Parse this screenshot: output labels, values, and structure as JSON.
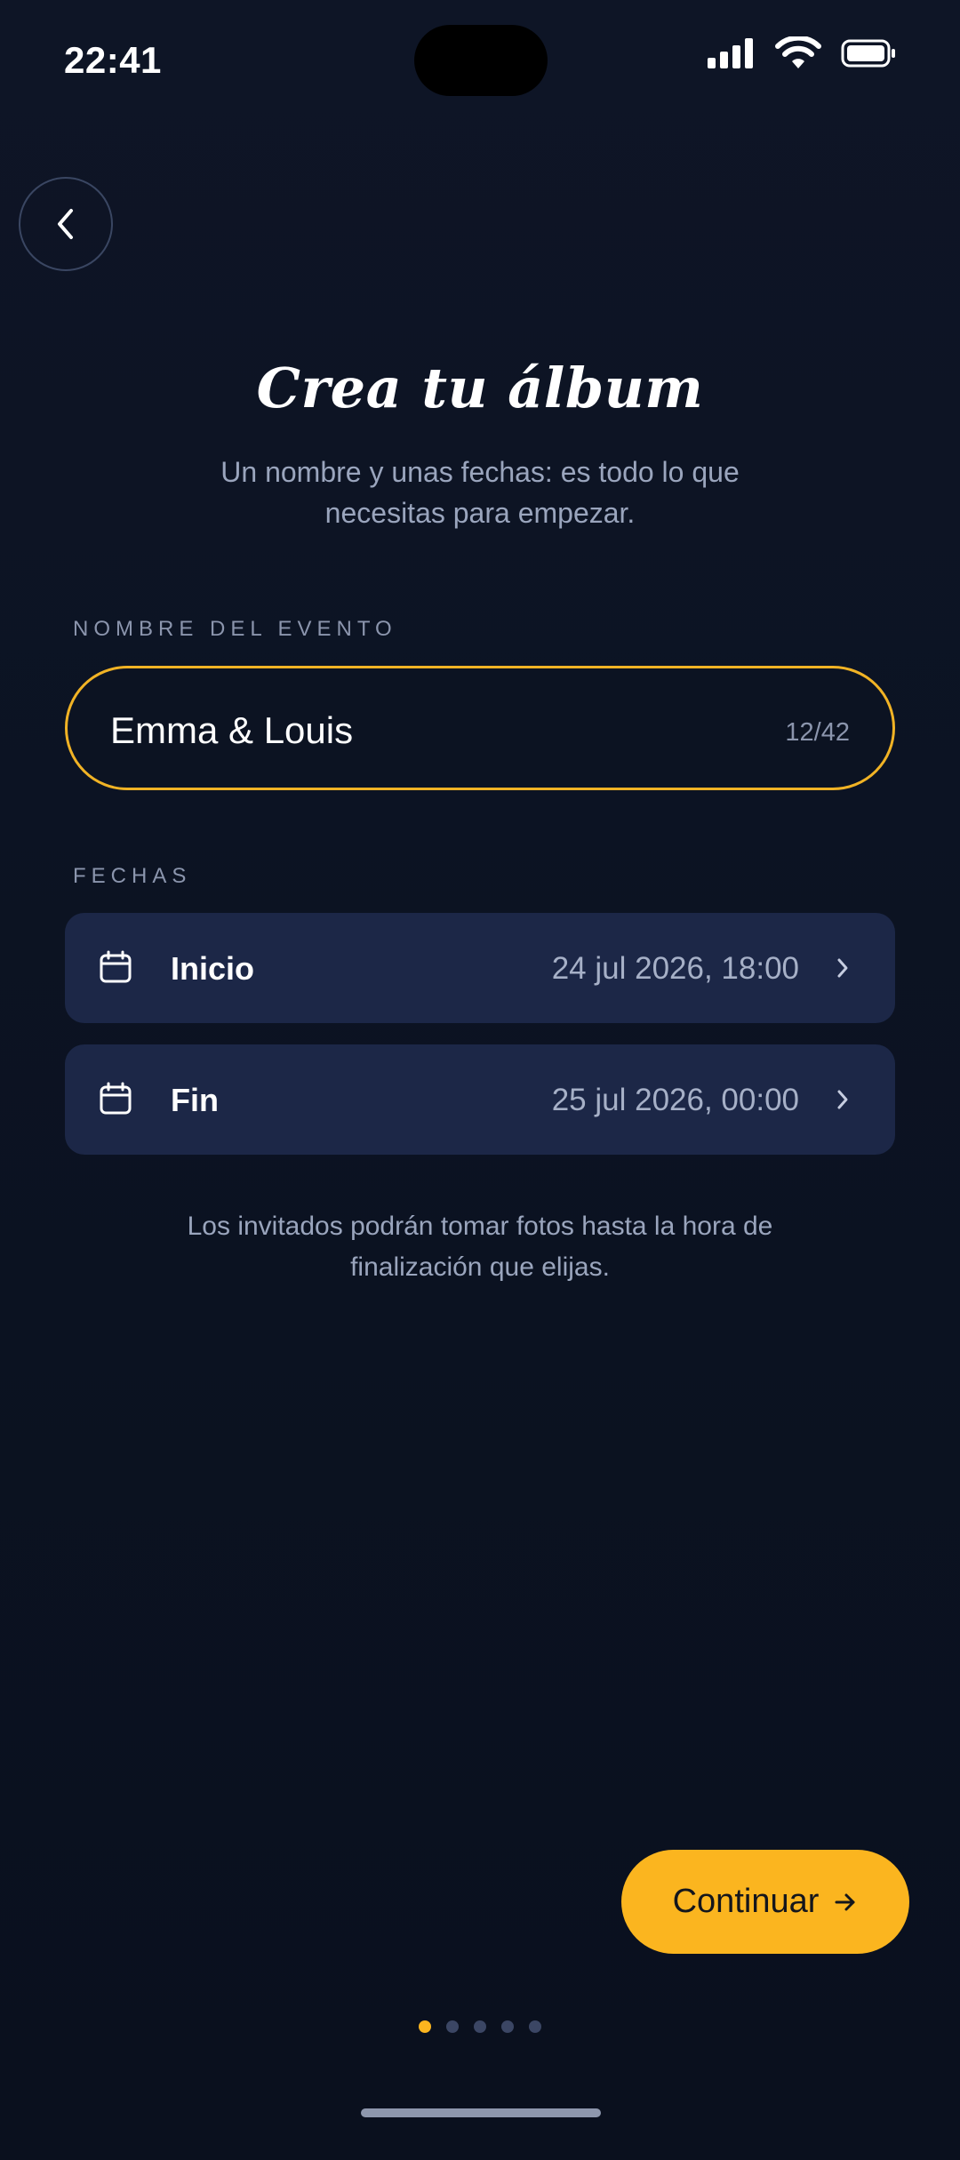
{
  "status_bar": {
    "time": "22:41",
    "icons": [
      "cellular-signal-icon",
      "wifi-icon",
      "battery-icon"
    ]
  },
  "header": {
    "back_icon": "chevron-left-icon",
    "title": "Crea tu álbum",
    "subtitle": "Un nombre y unas fechas: es todo lo que necesitas para empezar."
  },
  "event_name": {
    "label": "NOMBRE DEL EVENTO",
    "value": "Emma & Louis",
    "counter": "12/42"
  },
  "dates": {
    "label": "FECHAS",
    "rows": [
      {
        "label": "Inicio",
        "value": "24 jul 2026, 18:00",
        "icon": "calendar-icon"
      },
      {
        "label": "Fin",
        "value": "25 jul 2026, 00:00",
        "icon": "calendar-icon"
      }
    ]
  },
  "helper_text": "Los invitados podrán tomar fotos hasta la hora de finalización que elijas.",
  "continue_button": {
    "label": "Continuar",
    "icon": "arrow-right-icon"
  },
  "pagination": {
    "total": 5,
    "current": 1
  },
  "colors": {
    "background": "#0c1322",
    "accent": "#fbb51f",
    "card": "#1c2747",
    "muted_text": "#9aa5bd"
  }
}
